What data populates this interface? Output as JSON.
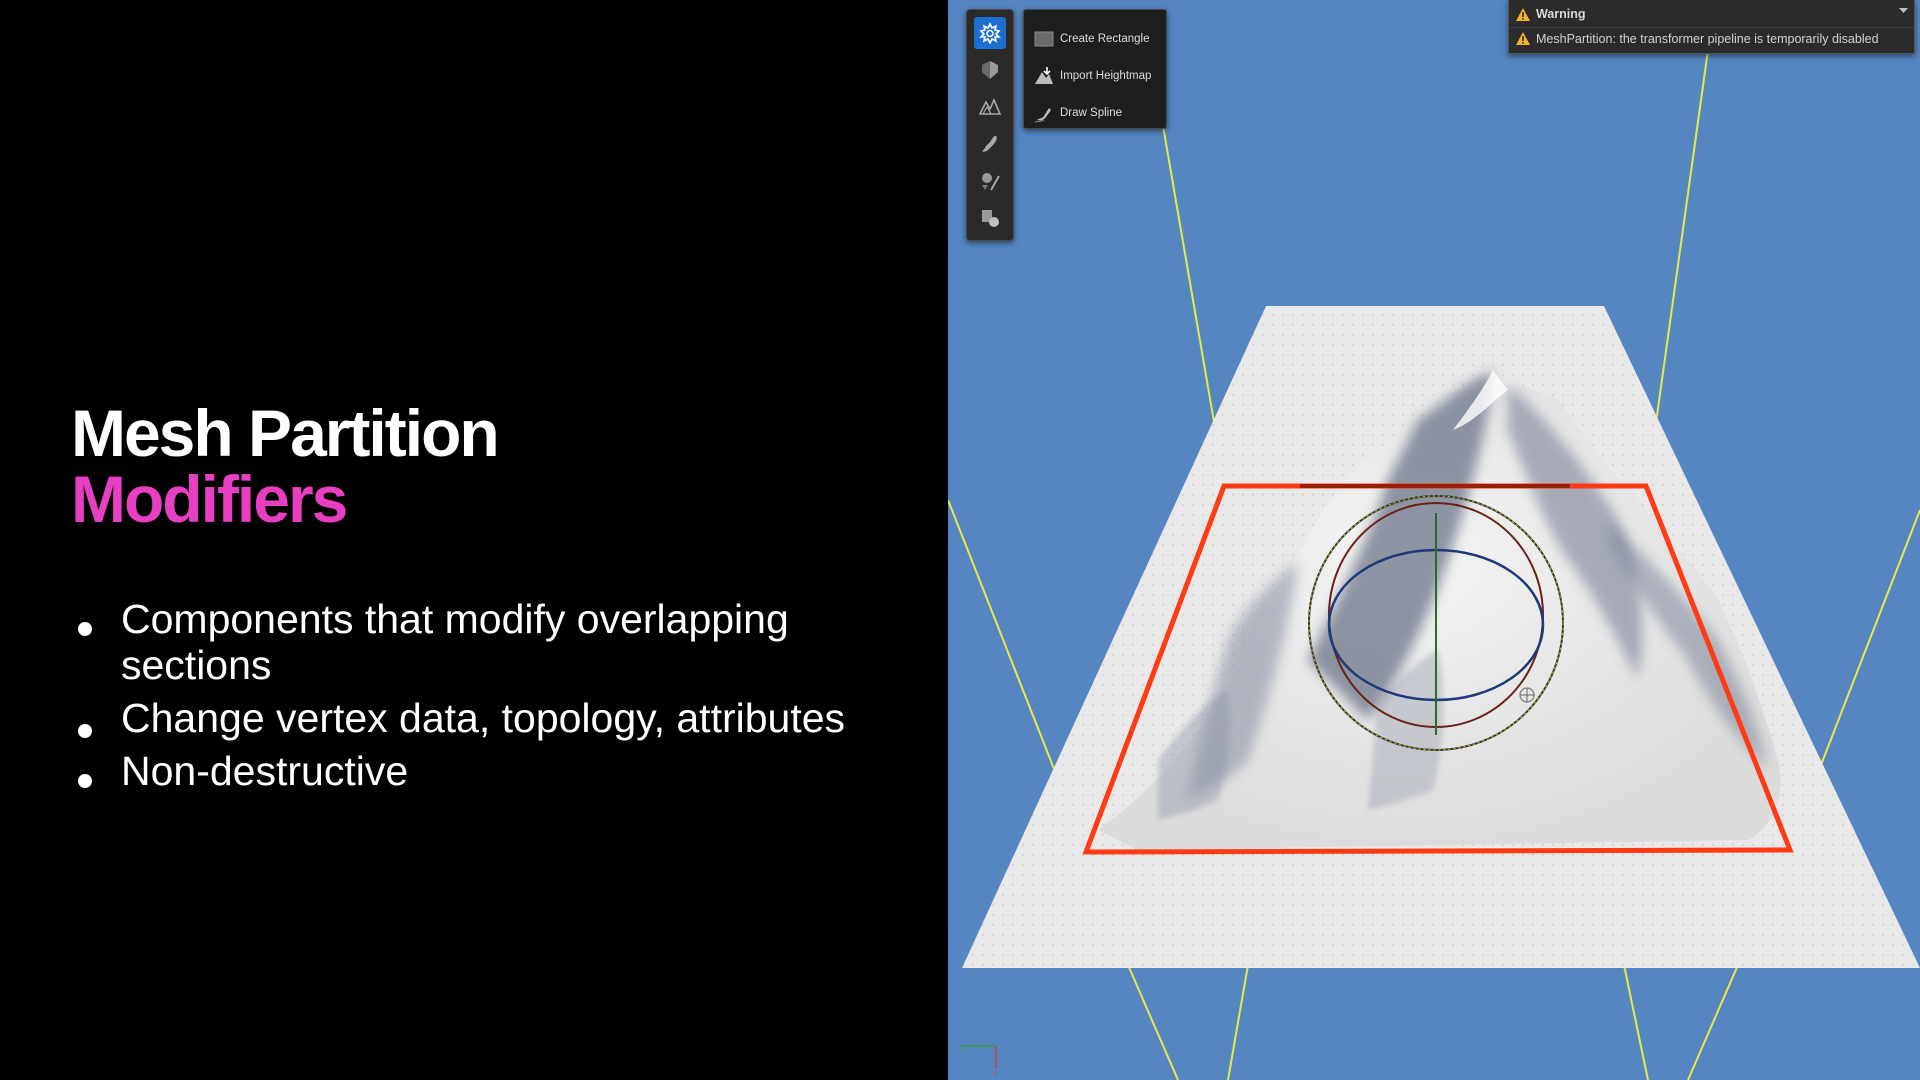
{
  "slide": {
    "title_line1": "Mesh Partition",
    "title_line2": "Modifiers",
    "bullets": [
      {
        "text": "Components that modify overlapping sections"
      },
      {
        "text": "Change vertex data, topology, attributes"
      },
      {
        "text": "Non-destructive"
      }
    ],
    "colors": {
      "title": "#ffffff",
      "accent": "#e83fc2",
      "background": "#000000"
    }
  },
  "viewport": {
    "background_color": "#5586c2",
    "toolbar": {
      "tools": [
        {
          "icon": "modifier-gear-icon",
          "active": true
        },
        {
          "icon": "shield-icon",
          "active": false
        },
        {
          "icon": "mountains-icon",
          "active": false
        },
        {
          "icon": "brush-icon",
          "active": false
        },
        {
          "icon": "paint-icon",
          "active": false
        },
        {
          "icon": "shapes-icon",
          "active": false
        }
      ]
    },
    "menu": {
      "items": [
        {
          "label": "Create Rectangle",
          "icon": "rectangle-icon"
        },
        {
          "label": "Import Heightmap",
          "icon": "import-heightmap-icon"
        },
        {
          "label": "Draw Spline",
          "icon": "pen-icon"
        }
      ]
    },
    "warning": {
      "title": "Warning",
      "message": "MeshPartition: the transformer pipeline is temporarily disabled",
      "icon": "warning-triangle-icon"
    },
    "scene": {
      "selection_color": "#ff3a14",
      "boundary_line_color": "#e8e84a"
    }
  }
}
